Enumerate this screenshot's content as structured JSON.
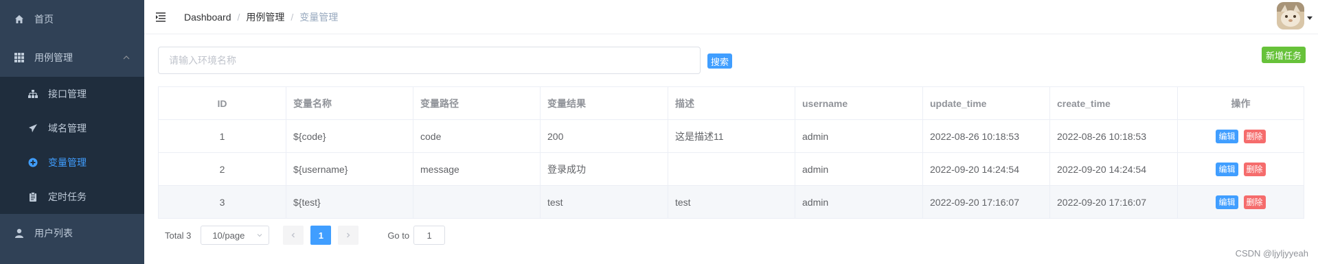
{
  "sidebar": {
    "home": "首页",
    "group": "用例管理",
    "sub_items": [
      {
        "label": "接口管理",
        "active": false
      },
      {
        "label": "域名管理",
        "active": false
      },
      {
        "label": "变量管理",
        "active": true
      },
      {
        "label": "定时任务",
        "active": false
      }
    ],
    "users": "用户列表"
  },
  "breadcrumb": [
    "Dashboard",
    "用例管理",
    "变量管理"
  ],
  "search": {
    "placeholder": "请输入环境名称",
    "value": ""
  },
  "buttons": {
    "search": "搜索",
    "add": "新增任务",
    "edit": "编辑",
    "delete": "删除"
  },
  "table": {
    "headers": [
      "ID",
      "变量名称",
      "变量路径",
      "变量结果",
      "描述",
      "username",
      "update_time",
      "create_time",
      "操作"
    ],
    "rows": [
      [
        "1",
        "${code}",
        "code",
        "200",
        "这是描述11",
        "admin",
        "2022-08-26 10:18:53",
        "2022-08-26 10:18:53"
      ],
      [
        "2",
        "${username}",
        "message",
        "登录成功",
        "",
        "admin",
        "2022-09-20 14:24:54",
        "2022-09-20 14:24:54"
      ],
      [
        "3",
        "${test}",
        "",
        "test",
        "test",
        "admin",
        "2022-09-20 17:16:07",
        "2022-09-20 17:16:07"
      ]
    ]
  },
  "pagination": {
    "total": "Total 3",
    "page_size": "10/page",
    "current_page": "1",
    "goto_label": "Go to",
    "goto_value": "1"
  },
  "watermark": "CSDN @ljyljyyeah",
  "colors": {
    "sidebar_bg": "#304156",
    "submenu_bg": "#1f2d3d",
    "primary": "#409eff",
    "success": "#67c23a",
    "danger": "#f56c6c"
  }
}
